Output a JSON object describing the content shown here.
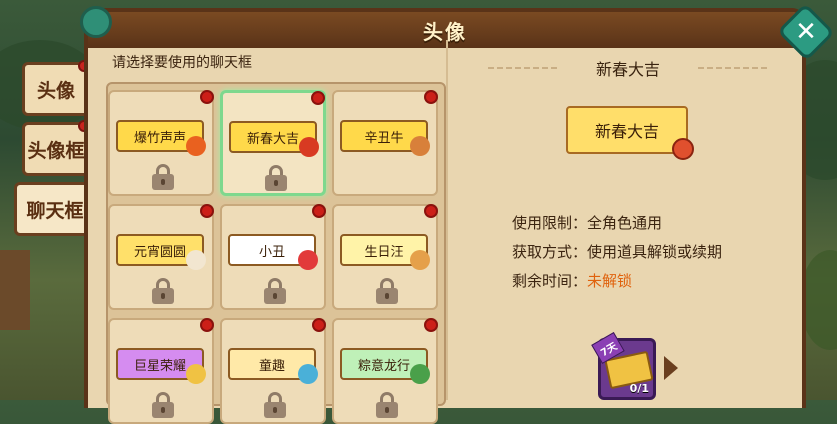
{
  "window": {
    "title": "头像"
  },
  "tabs": [
    {
      "label": "头像",
      "active": false
    },
    {
      "label": "头像框",
      "active": false
    },
    {
      "label": "聊天框",
      "active": true
    }
  ],
  "grid": {
    "prompt": "请选择要使用的聊天框",
    "cells": [
      {
        "label": "爆竹声声",
        "frame_color": "#ffd94a",
        "selected": false,
        "locked": true,
        "deco_color": "#e9611f"
      },
      {
        "label": "新春大吉",
        "frame_color": "#ffd94a",
        "selected": true,
        "locked": true,
        "deco_color": "#d83a22"
      },
      {
        "label": "辛丑牛",
        "frame_color": "#ffd94a",
        "selected": false,
        "locked": false,
        "deco_color": "#d8803a"
      },
      {
        "label": "元宵圆圆",
        "frame_color": "#ffe06a",
        "selected": false,
        "locked": true,
        "deco_color": "#f2e6d0"
      },
      {
        "label": "小丑",
        "frame_color": "#ffffff",
        "selected": false,
        "locked": true,
        "deco_color": "#e23a3a"
      },
      {
        "label": "生日汪",
        "frame_color": "#fff3a8",
        "selected": false,
        "locked": true,
        "deco_color": "#e5a04a"
      },
      {
        "label": "巨星荣耀",
        "frame_color": "#d58cf0",
        "selected": false,
        "locked": true,
        "deco_color": "#f0c243"
      },
      {
        "label": "童趣",
        "frame_color": "#ffe9a8",
        "selected": false,
        "locked": true,
        "deco_color": "#4ab0d8"
      },
      {
        "label": "粽意龙行",
        "frame_color": "#bff0b8",
        "selected": false,
        "locked": true,
        "deco_color": "#4aa04a"
      }
    ]
  },
  "detail": {
    "name": "新春大吉",
    "preview_label": "新春大吉",
    "usage_label": "使用限制：",
    "usage_value": "全角色通用",
    "obtain_label": "获取方式：",
    "obtain_value": "使用道具解锁或续期",
    "remaining_label": "剩余时间：",
    "remaining_value": "未解锁",
    "item": {
      "badge": "7天",
      "count": "0/1"
    }
  },
  "colors": {
    "panel": "#e9d6b0",
    "border": "#5a3318",
    "selected_glow": "#7ed88e",
    "warning": "#e0620d"
  }
}
